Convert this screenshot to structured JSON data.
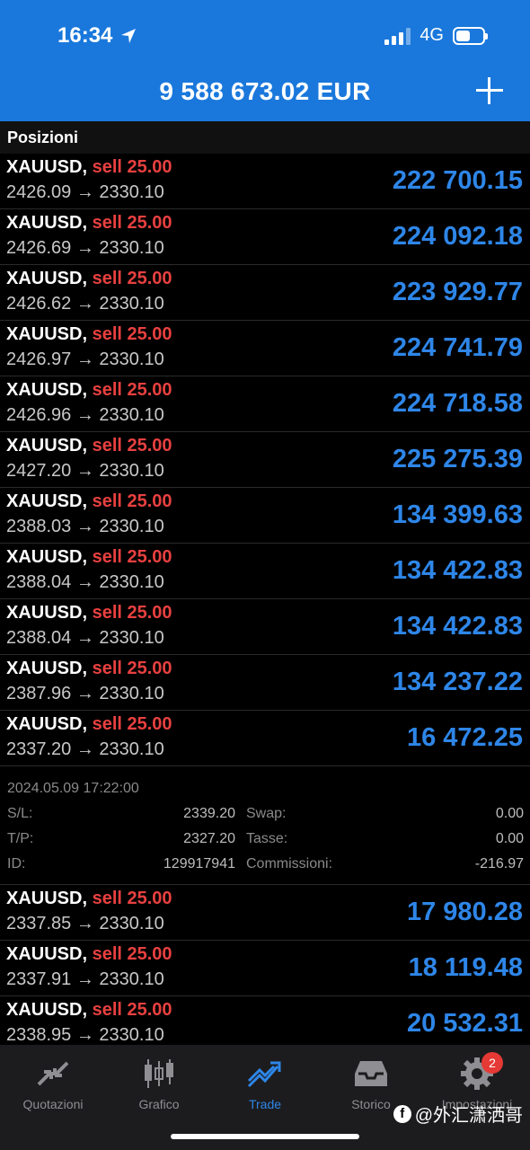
{
  "status_bar": {
    "time": "16:34",
    "network": "4G"
  },
  "header": {
    "balance": "9 588 673.02 EUR"
  },
  "section_title": "Posizioni",
  "positions_top": [
    {
      "symbol": "XAUUSD,",
      "action": "sell 25.00",
      "prices": "2426.09 → 2330.10",
      "profit": "222 700.15"
    },
    {
      "symbol": "XAUUSD,",
      "action": "sell 25.00",
      "prices": "2426.69 → 2330.10",
      "profit": "224 092.18"
    },
    {
      "symbol": "XAUUSD,",
      "action": "sell 25.00",
      "prices": "2426.62 → 2330.10",
      "profit": "223 929.77"
    },
    {
      "symbol": "XAUUSD,",
      "action": "sell 25.00",
      "prices": "2426.97 → 2330.10",
      "profit": "224 741.79"
    },
    {
      "symbol": "XAUUSD,",
      "action": "sell 25.00",
      "prices": "2426.96 → 2330.10",
      "profit": "224 718.58"
    },
    {
      "symbol": "XAUUSD,",
      "action": "sell 25.00",
      "prices": "2427.20 → 2330.10",
      "profit": "225 275.39"
    },
    {
      "symbol": "XAUUSD,",
      "action": "sell 25.00",
      "prices": "2388.03 → 2330.10",
      "profit": "134 399.63"
    },
    {
      "symbol": "XAUUSD,",
      "action": "sell 25.00",
      "prices": "2388.04 → 2330.10",
      "profit": "134 422.83"
    },
    {
      "symbol": "XAUUSD,",
      "action": "sell 25.00",
      "prices": "2388.04 → 2330.10",
      "profit": "134 422.83"
    },
    {
      "symbol": "XAUUSD,",
      "action": "sell 25.00",
      "prices": "2387.96 → 2330.10",
      "profit": "134 237.22"
    },
    {
      "symbol": "XAUUSD,",
      "action": "sell 25.00",
      "prices": "2337.20 → 2330.10",
      "profit": "16 472.25"
    }
  ],
  "details": {
    "datetime": "2024.05.09 17:22:00",
    "sl_label": "S/L:",
    "sl_value": "2339.20",
    "swap_label": "Swap:",
    "swap_value": "0.00",
    "tp_label": "T/P:",
    "tp_value": "2327.20",
    "tax_label": "Tasse:",
    "tax_value": "0.00",
    "id_label": "ID:",
    "id_value": "129917941",
    "commission_label": "Commissioni:",
    "commission_value": "-216.97"
  },
  "positions_bottom": [
    {
      "symbol": "XAUUSD,",
      "action": "sell 25.00",
      "prices": "2337.85 → 2330.10",
      "profit": "17 980.28"
    },
    {
      "symbol": "XAUUSD,",
      "action": "sell 25.00",
      "prices": "2337.91 → 2330.10",
      "profit": "18 119.48"
    },
    {
      "symbol": "XAUUSD,",
      "action": "sell 25.00",
      "prices": "2338.95 → 2330.10",
      "profit": "20 532.31"
    }
  ],
  "tabs": [
    {
      "label": "Quotazioni",
      "icon": "quotes-arrows-icon"
    },
    {
      "label": "Grafico",
      "icon": "candlestick-chart-icon"
    },
    {
      "label": "Trade",
      "icon": "trade-trend-icon",
      "active": true
    },
    {
      "label": "Storico",
      "icon": "inbox-history-icon"
    },
    {
      "label": "Impostazioni",
      "icon": "gear-icon",
      "badge": "2"
    }
  ],
  "watermark": "@外汇潇洒哥",
  "colors": {
    "header_blue": "#1a78dc",
    "profit_blue": "#2e86e8",
    "sell_red": "#e84040",
    "background": "#000000"
  }
}
